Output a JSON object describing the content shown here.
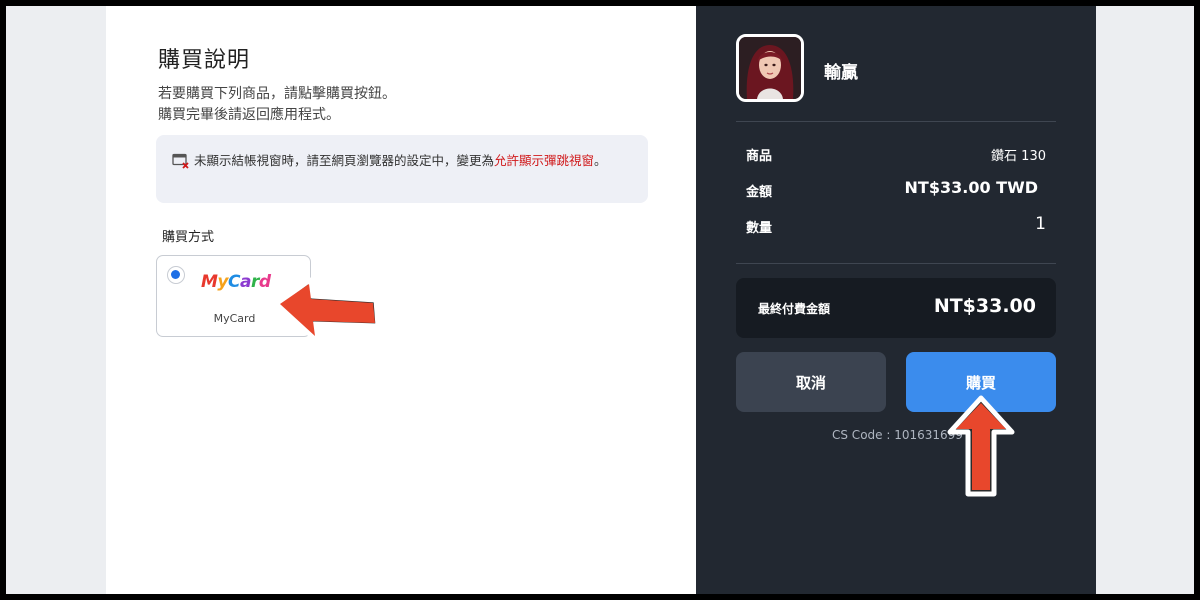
{
  "left": {
    "title": "購買說明",
    "desc_line1": "若要購買下列商品，請點擊購買按鈕。",
    "desc_line2": "購買完畢後請返回應用程式。",
    "notice_text": "未顯示結帳視窗時，請至網頁瀏覽器的設定中，變更為",
    "notice_link": "允許顯示彈跳視窗",
    "notice_end": "。",
    "method_label": "購買方式",
    "method_name": "MyCard",
    "logo_letters": [
      "M",
      "y",
      "C",
      "a",
      "r",
      "d"
    ]
  },
  "right": {
    "game_name": "輸贏",
    "rows": [
      {
        "label": "商品",
        "value": "鑽石 130"
      },
      {
        "label": "金額",
        "value": "NT$33.00  TWD"
      },
      {
        "label": "數量",
        "value": "1"
      }
    ],
    "total_label": "最終付費金額",
    "total_value": "NT$33.00",
    "cancel_label": "取消",
    "buy_label": "購買",
    "cs_code": "CS Code : 101631699"
  },
  "colors": {
    "accent": "#3b8ced",
    "dark_panel": "#222831",
    "link_red": "#d0191b",
    "arrow_red": "#e8472c"
  }
}
